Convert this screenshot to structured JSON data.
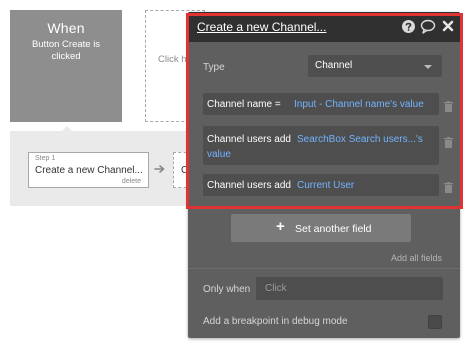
{
  "event": {
    "title": "When",
    "description_line1": "Button Create is",
    "description_line2": "clicked"
  },
  "placeholder": {
    "label": "Click h"
  },
  "workflow": {
    "step_number": "Step 1",
    "step_title": "Create a new Channel...",
    "step_delete": "delete",
    "next_step_label": "C"
  },
  "panel": {
    "title": "Create a new Channel...",
    "type_label": "Type",
    "type_value": "Channel",
    "fields": [
      {
        "label": "Channel name =",
        "value": "Input - Channel name's value"
      },
      {
        "label": "Channel users add",
        "value_line1": "SearchBox Search users...'s",
        "value_line2": "value"
      },
      {
        "label": "Channel users add",
        "value": "Current User"
      }
    ],
    "set_field_label": "Set another field",
    "add_all_label": "Add all fields",
    "only_when_label": "Only when",
    "only_when_placeholder": "Click",
    "breakpoint_label": "Add a breakpoint in debug mode"
  },
  "colors": {
    "highlight": "#e03333",
    "dynamic_value": "#73b3ff",
    "panel_bg": "#5f5f5f",
    "header_bg": "#303030"
  },
  "icons": [
    "help-icon",
    "comment-icon",
    "close-icon",
    "chevron-down-icon",
    "trash-icon",
    "plus-icon",
    "arrow-right-icon"
  ]
}
